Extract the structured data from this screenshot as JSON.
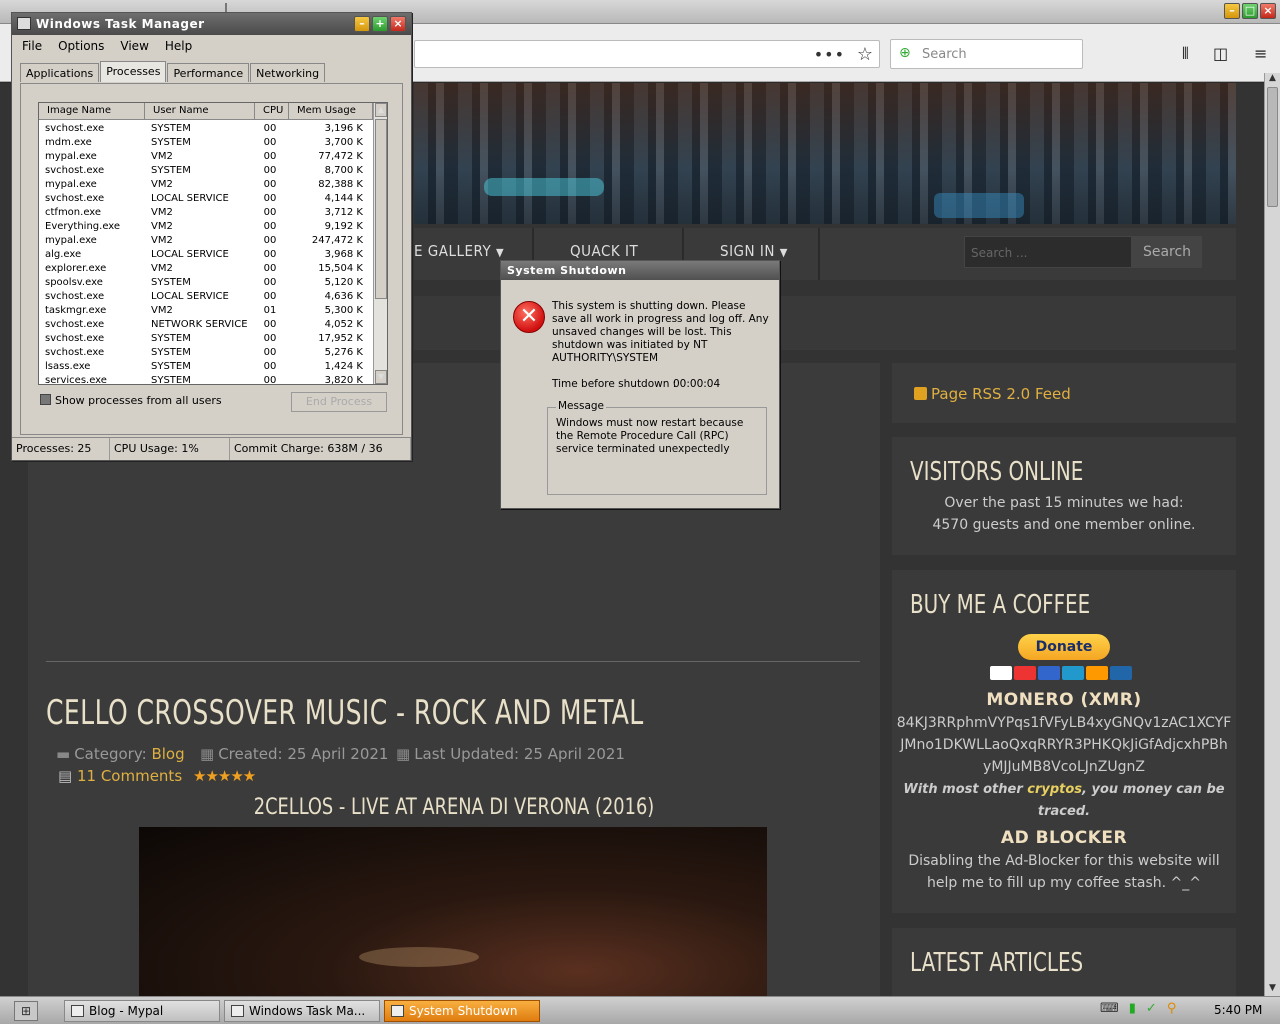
{
  "browser": {
    "search_placeholder": "Search",
    "url_actions": "•••",
    "star": "☆"
  },
  "site": {
    "nav": [
      "E GALLERY",
      "QUACK IT",
      "SIGN IN"
    ],
    "nav_caret": "▼",
    "search_placeholder": "Search ...",
    "search_button": "Search",
    "article": {
      "title": "CELLO CROSSOVER MUSIC - ROCK AND METAL",
      "category_label": "Category:",
      "category": "Blog",
      "created": "Created: 25 April 2021",
      "updated": "Last Updated: 25 April 2021",
      "comments": "11 Comments",
      "stars": "★★★★★",
      "rating": 5,
      "video_title": "2CELLOS - LIVE AT ARENA DI VERONA (2016)"
    },
    "sidebar": {
      "rss": "Page RSS 2.0 Feed",
      "visitors_heading": "VISITORS ONLINE",
      "visitors_line1": "Over the past 15 minutes we had:",
      "visitors_line2": "4570 guests and one member online.",
      "coffee_heading": "BUY ME A COFFEE",
      "donate": "Donate",
      "monero_heading": "MONERO (XMR)",
      "monero_addr1": "84KJ3RRphmVYPqs1fVFyLB4xyGNQv1zAC1XCYF",
      "monero_addr2": "JMno1DKWLLaoQxqRRYR3PHKQkJiGfAdjcxhPBh",
      "monero_addr3": "yMJJuMB8VcoLJnZUgnZ",
      "cryptos_pre": "With most other ",
      "cryptos_hl": "cryptos",
      "cryptos_post": ", you money can be",
      "cryptos_line2": "traced.",
      "adblock_heading": "AD BLOCKER",
      "adblock_line1": "Disabling the Ad-Blocker for this website will",
      "adblock_line2": "help me to fill up my coffee stash. ^_^",
      "latest_heading": "LATEST ARTICLES"
    }
  },
  "taskmgr": {
    "title": "Windows Task Manager",
    "menu": [
      "File",
      "Options",
      "View",
      "Help"
    ],
    "tabs": [
      "Applications",
      "Processes",
      "Performance",
      "Networking"
    ],
    "active_tab": "Processes",
    "columns": [
      "Image Name",
      "User Name",
      "CPU",
      "Mem Usage"
    ],
    "processes": [
      [
        "svchost.exe",
        "SYSTEM",
        "00",
        "3,196 K"
      ],
      [
        "mdm.exe",
        "SYSTEM",
        "00",
        "3,700 K"
      ],
      [
        "mypal.exe",
        "VM2",
        "00",
        "77,472 K"
      ],
      [
        "svchost.exe",
        "SYSTEM",
        "00",
        "8,700 K"
      ],
      [
        "mypal.exe",
        "VM2",
        "00",
        "82,388 K"
      ],
      [
        "svchost.exe",
        "LOCAL SERVICE",
        "00",
        "4,144 K"
      ],
      [
        "ctfmon.exe",
        "VM2",
        "00",
        "3,712 K"
      ],
      [
        "Everything.exe",
        "VM2",
        "00",
        "9,192 K"
      ],
      [
        "mypal.exe",
        "VM2",
        "00",
        "247,472 K"
      ],
      [
        "alg.exe",
        "LOCAL SERVICE",
        "00",
        "3,968 K"
      ],
      [
        "explorer.exe",
        "VM2",
        "00",
        "15,504 K"
      ],
      [
        "spoolsv.exe",
        "SYSTEM",
        "00",
        "5,120 K"
      ],
      [
        "svchost.exe",
        "LOCAL SERVICE",
        "00",
        "4,636 K"
      ],
      [
        "taskmgr.exe",
        "VM2",
        "01",
        "5,300 K"
      ],
      [
        "svchost.exe",
        "NETWORK SERVICE",
        "00",
        "4,052 K"
      ],
      [
        "svchost.exe",
        "SYSTEM",
        "00",
        "17,952 K"
      ],
      [
        "svchost.exe",
        "SYSTEM",
        "00",
        "5,276 K"
      ],
      [
        "lsass.exe",
        "SYSTEM",
        "00",
        "1,424 K"
      ],
      [
        "services.exe",
        "SYSTEM",
        "00",
        "3,820 K"
      ]
    ],
    "show_all": "Show processes from all users",
    "end_process": "End Process",
    "status_processes": "Processes: 25",
    "status_cpu": "CPU Usage: 1%",
    "status_commit": "Commit Charge: 638M / 36"
  },
  "shutdown": {
    "title": "System Shutdown",
    "message": "This system is shutting down. Please save all work in progress and log off. Any unsaved changes will be lost. This shutdown was initiated by NT AUTHORITY\\SYSTEM",
    "time_label": "Time before shutdown :",
    "time_value": "00:00:04",
    "group_label": "Message",
    "reason": "Windows must now restart because the Remote Procedure Call (RPC) service terminated unexpectedly"
  },
  "taskbar": {
    "tasks": [
      "Blog - Mypal",
      "Windows Task Ma...",
      "System Shutdown"
    ],
    "active_task": "System Shutdown",
    "clock": "5:40 PM"
  }
}
